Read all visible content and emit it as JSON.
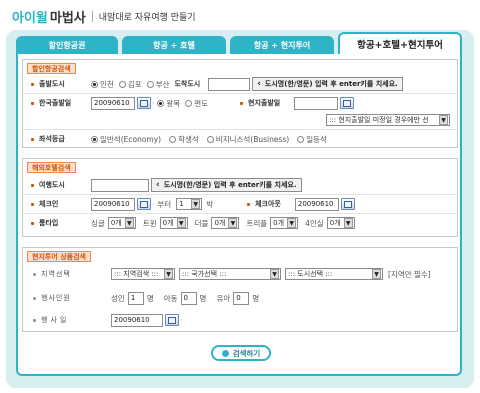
{
  "header": {
    "brand_a": "아이윌",
    "brand_b": "마법사",
    "tagline": "내맘대로 자유여행 만들기"
  },
  "tabs": [
    {
      "label": "할인항공권",
      "active": false
    },
    {
      "label": "항공 + 호텔",
      "active": false
    },
    {
      "label": "항공 + 현지투어",
      "active": false
    },
    {
      "label": "항공+호텔+현지투어",
      "active": true
    }
  ],
  "air": {
    "title": "할인항공검색",
    "depart_city_label": "출발도시",
    "depart_options": [
      "인천",
      "김포",
      "부산"
    ],
    "arrive_city_label": "도착도시",
    "arrive_city_value": "",
    "city_hint": "도시명(한/영문) 입력 후 enter키를 치세요.",
    "kr_depart_label": "한국출발일",
    "kr_depart_value": "20090610",
    "trip_options": [
      "왕복",
      "편도"
    ],
    "local_depart_label": "현지출발일",
    "local_depart_value": "",
    "local_undecided": "::: 현지출발일 미정일 경우에만 선",
    "seat_label": "좌석등급",
    "seat_options": [
      "일반석(Economy)",
      "학생석",
      "비지니스석(Business)",
      "일등석"
    ]
  },
  "hotel": {
    "title": "해외호텔검색",
    "city_label": "여행도시",
    "city_value": "",
    "city_hint": "도시명(한/영문) 입력 후 enter키를 치세요.",
    "checkin_label": "체크인",
    "checkin_value": "20090610",
    "from_text": "부터",
    "nights_value": "1",
    "nights_unit": "박",
    "checkout_label": "체크아웃",
    "checkout_value": "20090610",
    "room_type_label": "룸타입",
    "rooms": [
      {
        "label": "싱글",
        "value": "0개"
      },
      {
        "label": "트윈",
        "value": "0개"
      },
      {
        "label": "더블",
        "value": "0개"
      },
      {
        "label": "트리플",
        "value": "0개"
      },
      {
        "label": "4인실",
        "value": "0개"
      }
    ]
  },
  "tour": {
    "title": "현지투어 상품검색",
    "region_label": "지역선택",
    "region_sel": "::: 지역검색 :::",
    "country_sel": "::: 국가선택 :::",
    "city_sel": "::: 도시선택 :::",
    "required_note": "[지역만 필수]",
    "people_label": "행사인원",
    "adult_label": "성인",
    "adult_value": "1",
    "child_label": "아동",
    "child_value": "0",
    "infant_label": "유아",
    "infant_value": "0",
    "unit": "명",
    "date_label": "행사일",
    "date_value": "20090610"
  },
  "search_label": "검색하기"
}
